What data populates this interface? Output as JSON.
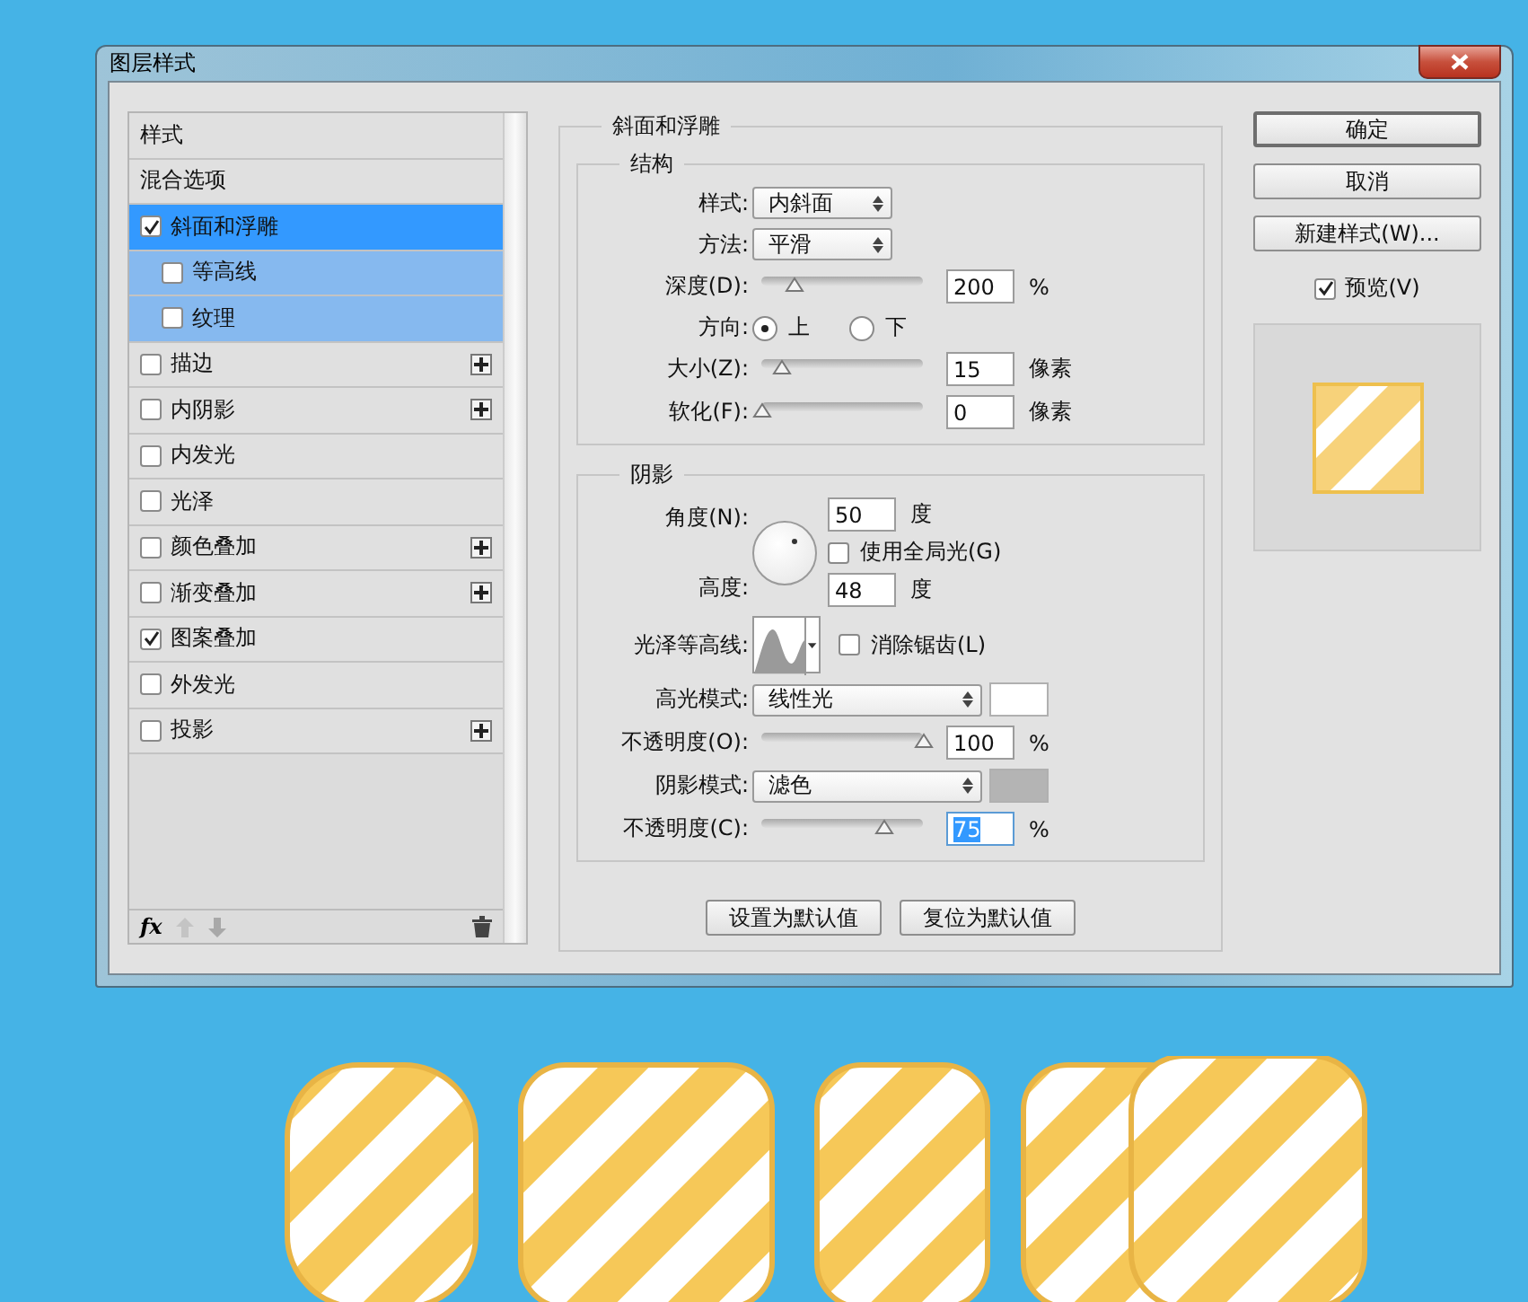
{
  "window": {
    "title": "图层样式"
  },
  "styles": {
    "items": [
      {
        "label": "样式",
        "kind": "heading",
        "selected": false
      },
      {
        "label": "混合选项",
        "kind": "heading",
        "selected": false
      },
      {
        "label": "斜面和浮雕",
        "kind": "checkbox",
        "checked": true,
        "selected": true,
        "addable": false,
        "children": [
          {
            "label": "等高线",
            "checked": false,
            "selected": false
          },
          {
            "label": "纹理",
            "checked": false,
            "selected": false
          }
        ]
      },
      {
        "label": "描边",
        "kind": "checkbox",
        "checked": false,
        "selected": false,
        "addable": true
      },
      {
        "label": "内阴影",
        "kind": "checkbox",
        "checked": false,
        "selected": false,
        "addable": true
      },
      {
        "label": "内发光",
        "kind": "checkbox",
        "checked": false,
        "selected": false,
        "addable": false
      },
      {
        "label": "光泽",
        "kind": "checkbox",
        "checked": false,
        "selected": false,
        "addable": false
      },
      {
        "label": "颜色叠加",
        "kind": "checkbox",
        "checked": false,
        "selected": false,
        "addable": true
      },
      {
        "label": "渐变叠加",
        "kind": "checkbox",
        "checked": false,
        "selected": false,
        "addable": true
      },
      {
        "label": "图案叠加",
        "kind": "checkbox",
        "checked": true,
        "selected": false,
        "addable": false
      },
      {
        "label": "外发光",
        "kind": "checkbox",
        "checked": false,
        "selected": false,
        "addable": false
      },
      {
        "label": "投影",
        "kind": "checkbox",
        "checked": false,
        "selected": false,
        "addable": true
      }
    ],
    "fx": "fx"
  },
  "bevel": {
    "title": "斜面和浮雕",
    "structure": {
      "title": "结构",
      "style": {
        "label": "样式:",
        "value": "内斜面"
      },
      "technique": {
        "label": "方法:",
        "value": "平滑"
      },
      "depth": {
        "label": "深度(D):",
        "level": 0.2,
        "value": "200",
        "unit": "%"
      },
      "direction": {
        "label": "方向:",
        "options": [
          {
            "label": "上",
            "selected": true
          },
          {
            "label": "下",
            "selected": false
          }
        ]
      },
      "size": {
        "label": "大小(Z):",
        "level": 0.12,
        "value": "15",
        "unit": "像素"
      },
      "soften": {
        "label": "软化(F):",
        "level": 0,
        "value": "0",
        "unit": "像素"
      }
    },
    "shading": {
      "title": "阴影",
      "angle": {
        "label": "角度(N):",
        "value": "50",
        "unit": "度"
      },
      "global_light": {
        "label": "使用全局光(G)",
        "checked": false
      },
      "altitude": {
        "label": "高度:",
        "value": "48",
        "unit": "度"
      },
      "gloss_contour": {
        "label": "光泽等高线:"
      },
      "anti_aliased": {
        "label": "消除锯齿(L)",
        "checked": false
      },
      "highlight_mode": {
        "label": "高光模式:",
        "value": "线性光",
        "color": "#ffffff"
      },
      "highlight_opacity": {
        "label": "不透明度(O):",
        "level": 1,
        "value": "100",
        "unit": "%",
        "text_selected": false
      },
      "shadow_mode": {
        "label": "阴影模式:",
        "value": "滤色",
        "color": "#b4b4b4"
      },
      "shadow_opacity": {
        "label": "不透明度(C):",
        "level": 0.75,
        "value": "75",
        "unit": "%",
        "text_selected": true
      }
    },
    "buttons": [
      {
        "label": "设置为默认值"
      },
      {
        "label": "复位为默认值"
      }
    ]
  },
  "actions": {
    "buttons": [
      {
        "label": "确定",
        "default": true
      },
      {
        "label": "取消",
        "default": false
      },
      {
        "label": "新建样式(W)...",
        "default": false
      }
    ],
    "preview": {
      "label": "预览(V)",
      "checked": true
    }
  }
}
